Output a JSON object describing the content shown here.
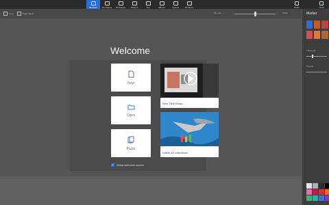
{
  "toolbar": {
    "tabs": [
      {
        "label": "Brushes",
        "active": true
      },
      {
        "label": "2D shapes",
        "active": false
      },
      {
        "label": "3D shapes",
        "active": false
      },
      {
        "label": "Stickers",
        "active": false
      },
      {
        "label": "Text",
        "active": false
      },
      {
        "label": "Effects",
        "active": false
      },
      {
        "label": "Canvas",
        "active": false
      },
      {
        "label": "3D library",
        "active": false
      }
    ],
    "right": [
      {
        "label": "Paste"
      },
      {
        "label": "Undo"
      }
    ]
  },
  "subbar": {
    "items": [
      {
        "label": "Crop"
      },
      {
        "label": "Magic select"
      }
    ],
    "view3d": "3D view",
    "zoom": "100%"
  },
  "welcome": {
    "title": "Welcome",
    "tiles": [
      {
        "label": "New",
        "icon": "new-file-icon"
      },
      {
        "label": "Open",
        "icon": "folder-icon"
      },
      {
        "label": "Paste",
        "icon": "paste-icon"
      }
    ],
    "cards": [
      {
        "caption": "New Tube Brush"
      },
      {
        "caption": "Latest 3D collections"
      }
    ],
    "show_screen": "Show welcome screen"
  },
  "sidepanel": {
    "title": "Marker",
    "thickness_label": "Thickness",
    "opacity_label": "Opacity",
    "thickness_level": 0.25,
    "colors": [
      "#e8e8e8",
      "#b0b0b0",
      "#2d2d2d",
      "#000000",
      "#f06ab0",
      "#c31e45",
      "#e03030",
      "#f26722",
      "#3cb371",
      "#2cb5a8",
      "#3a78d6",
      "#7b3fb8"
    ],
    "accent": "#2a6fd6"
  }
}
